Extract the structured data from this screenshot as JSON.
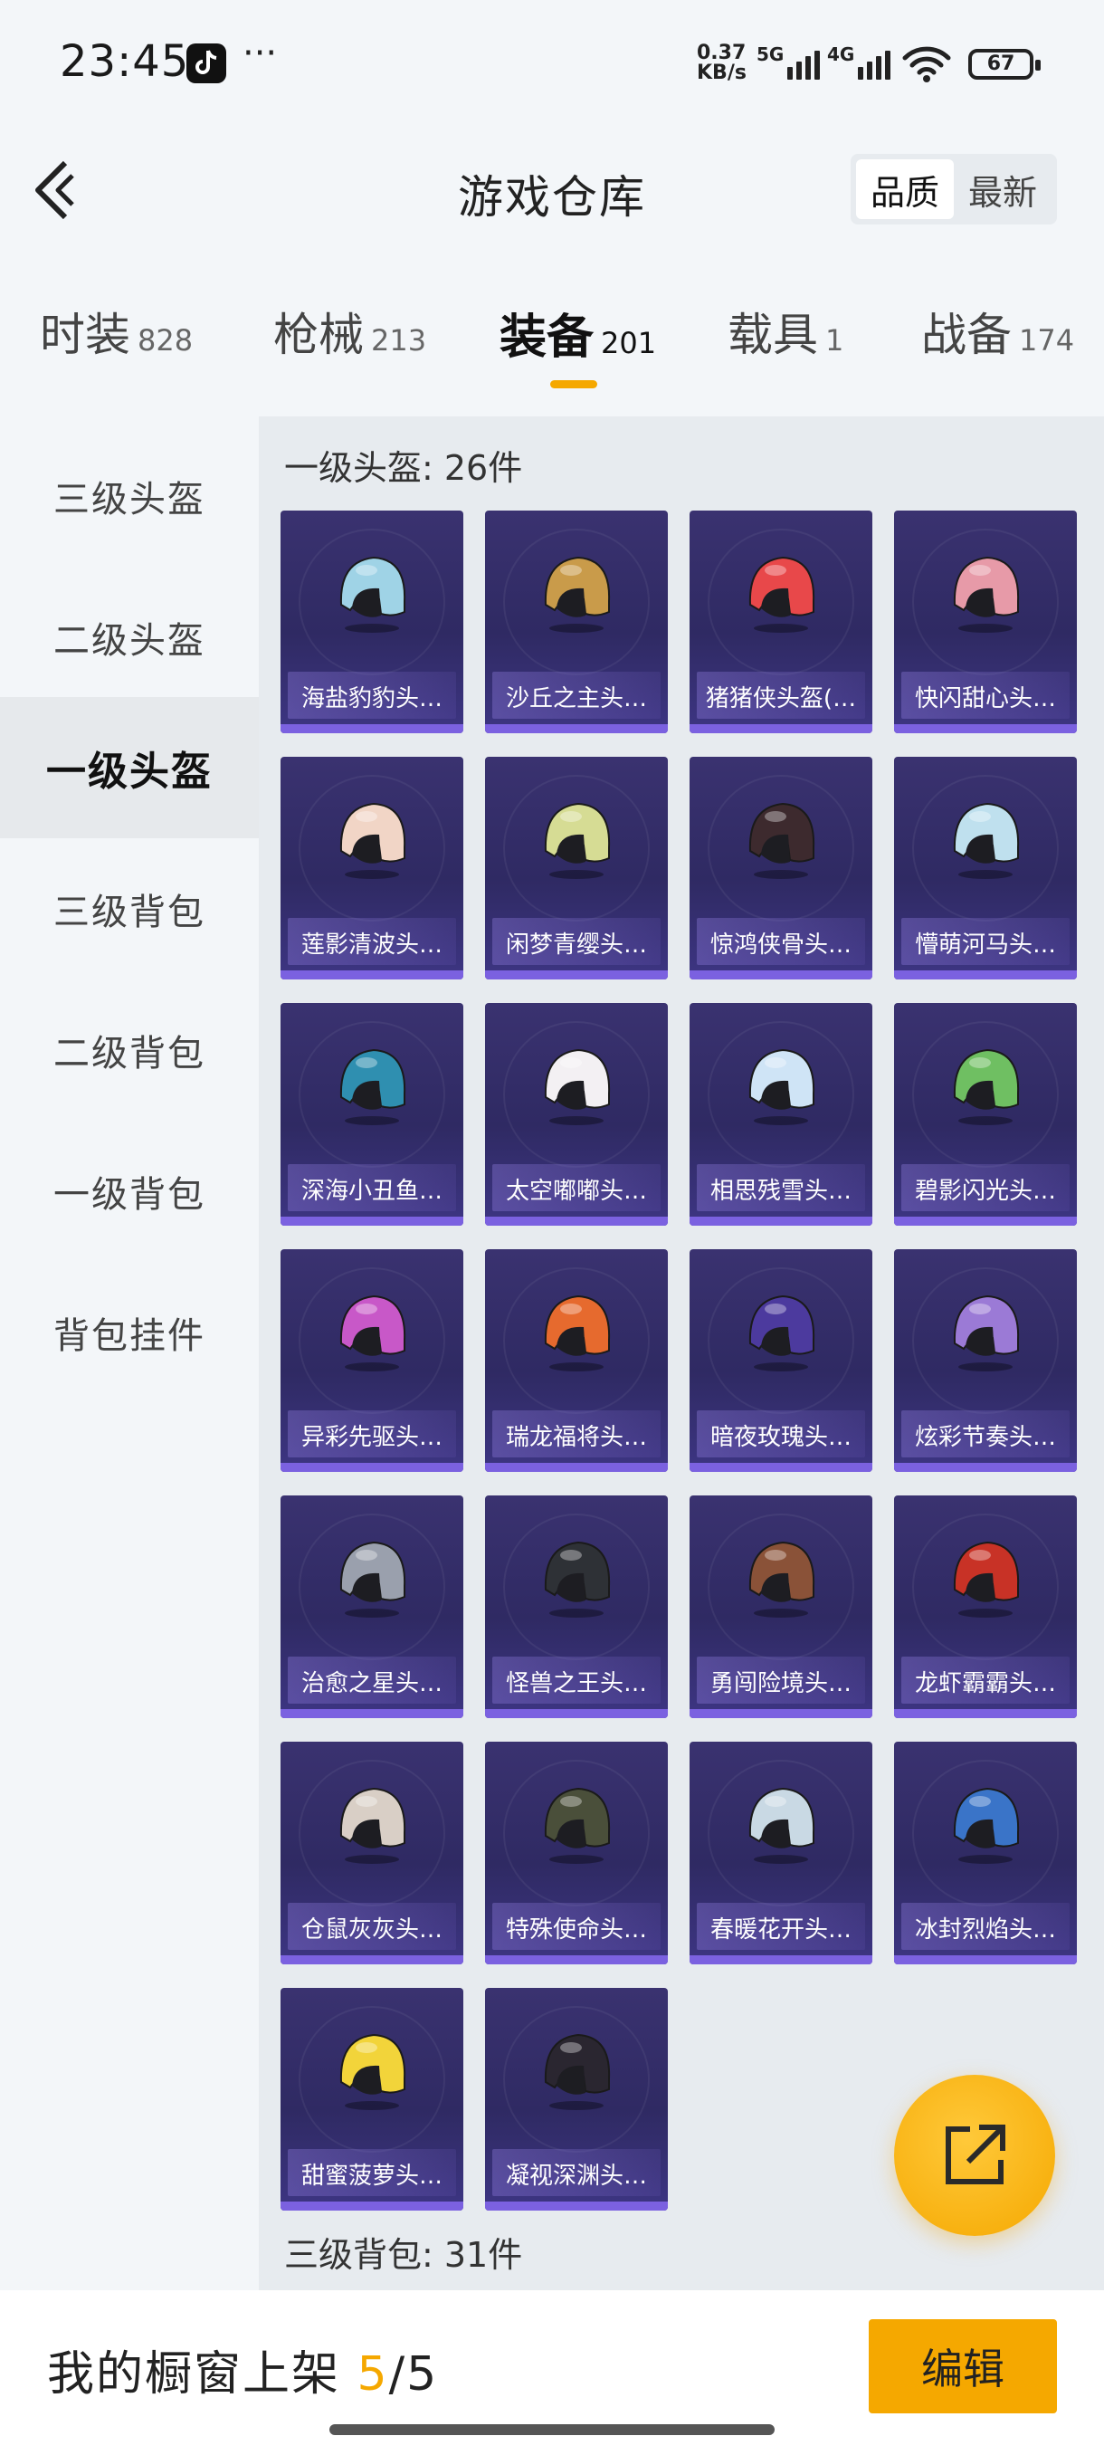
{
  "status": {
    "time": "23:45",
    "more": "···",
    "speed_value": "0.37",
    "speed_unit": "KB/s",
    "sig1": "5G",
    "sig2": "4G",
    "battery": "67"
  },
  "header": {
    "title": "游戏仓库",
    "sort_quality": "品质",
    "sort_latest": "最新"
  },
  "tabs": [
    {
      "label": "时装",
      "count": "828"
    },
    {
      "label": "枪械",
      "count": "213"
    },
    {
      "label": "装备",
      "count": "201"
    },
    {
      "label": "载具",
      "count": "1"
    },
    {
      "label": "战备",
      "count": "174"
    }
  ],
  "sidebar": {
    "items": [
      {
        "label": "三级头盔"
      },
      {
        "label": "二级头盔"
      },
      {
        "label": "一级头盔"
      },
      {
        "label": "三级背包"
      },
      {
        "label": "二级背包"
      },
      {
        "label": "一级背包"
      },
      {
        "label": "背包挂件"
      }
    ]
  },
  "sections": [
    {
      "title": "一级头盔: 26件"
    },
    {
      "title": "三级背包: 31件"
    }
  ],
  "items": [
    {
      "name": "海盐豹豹头…",
      "color": "#9fd3e6"
    },
    {
      "name": "沙丘之主头…",
      "color": "#c99b4a"
    },
    {
      "name": "猪猪侠头盔(…",
      "color": "#e8484a"
    },
    {
      "name": "快闪甜心头…",
      "color": "#e79aa8"
    },
    {
      "name": "莲影清波头…",
      "color": "#f1d5c6"
    },
    {
      "name": "闲梦青缨头…",
      "color": "#d6dc94"
    },
    {
      "name": "惊鸿侠骨头…",
      "color": "#3d2a2e"
    },
    {
      "name": "懵萌河马头…",
      "color": "#bfe0ee"
    },
    {
      "name": "深海小丑鱼…",
      "color": "#2f8fb0"
    },
    {
      "name": "太空嘟嘟头…",
      "color": "#f3f0f3"
    },
    {
      "name": "相思残雪头…",
      "color": "#cfe4f6"
    },
    {
      "name": "碧影闪光头…",
      "color": "#6fbf62"
    },
    {
      "name": "异彩先驱头…",
      "color": "#c858c8"
    },
    {
      "name": "瑞龙福将头…",
      "color": "#e66a2e"
    },
    {
      "name": "暗夜玫瑰头…",
      "color": "#4c3a9e"
    },
    {
      "name": "炫彩节奏头…",
      "color": "#9b7ad6"
    },
    {
      "name": "治愈之星头…",
      "color": "#9aa0ad"
    },
    {
      "name": "怪兽之王头…",
      "color": "#2e3136"
    },
    {
      "name": "勇闯险境头…",
      "color": "#8a5238"
    },
    {
      "name": "龙虾霸霸头…",
      "color": "#c83226"
    },
    {
      "name": "仓鼠灰灰头…",
      "color": "#d9cfc6"
    },
    {
      "name": "特殊使命头…",
      "color": "#4a4f3a"
    },
    {
      "name": "春暖花开头…",
      "color": "#c9d9e4"
    },
    {
      "name": "冰封烈焰头…",
      "color": "#3a74c8"
    },
    {
      "name": "甜蜜菠萝头…",
      "color": "#f2d43a"
    },
    {
      "name": "凝视深渊头…",
      "color": "#2a2630"
    }
  ],
  "bottom": {
    "label": "我的橱窗上架",
    "current": "5",
    "total": "/5",
    "edit": "编辑"
  }
}
